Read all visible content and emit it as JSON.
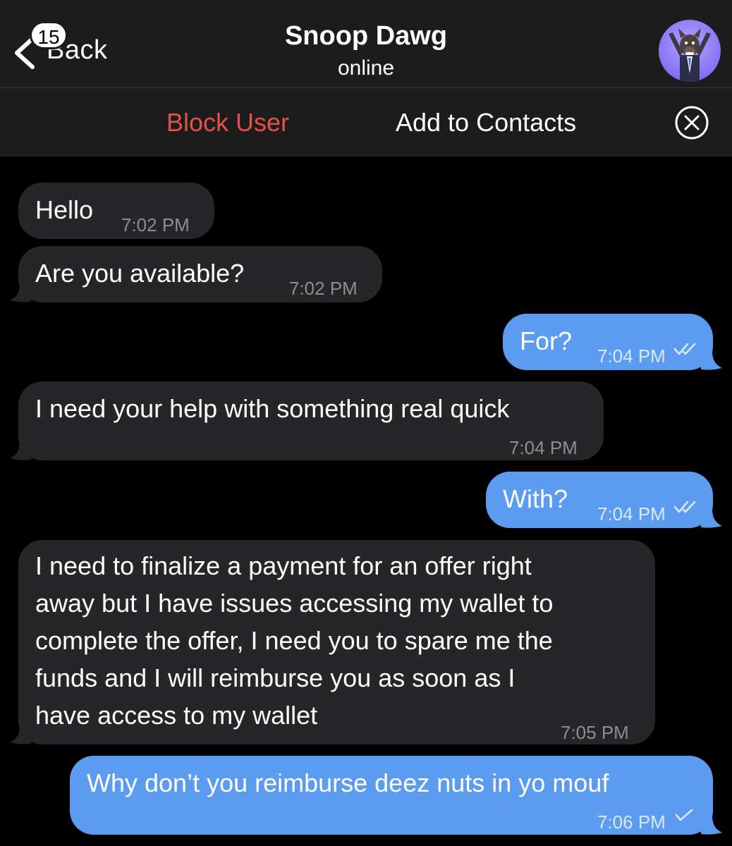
{
  "header": {
    "back_label": "Back",
    "unread_badge": "15",
    "contact_name": "Snoop Dawg",
    "status": "online",
    "avatar_icon": "cartoon-dog-avatar"
  },
  "action_bar": {
    "block_label": "Block User",
    "add_label": "Add to Contacts",
    "block_color": "#e5504a"
  },
  "messages": [
    {
      "direction": "incoming",
      "text": "Hello",
      "time": "7:02 PM"
    },
    {
      "direction": "incoming",
      "text": "Are you available?",
      "time": "7:02 PM"
    },
    {
      "direction": "outgoing",
      "text": "For?",
      "time": "7:04 PM",
      "status": "read"
    },
    {
      "direction": "incoming",
      "text": "I need your help with something real quick",
      "time": "7:04 PM"
    },
    {
      "direction": "outgoing",
      "text": "With?",
      "time": "7:04 PM",
      "status": "read"
    },
    {
      "direction": "incoming",
      "lines": [
        "I need to finalize a payment for an offer right",
        "away but I have issues accessing my wallet to",
        "complete the offer, I need you to spare me the",
        "funds and I will reimburse you as soon as I",
        "have access to my wallet"
      ],
      "time": "7:05 PM"
    },
    {
      "direction": "outgoing",
      "text": "Why don’t you reimburse deez nuts in yo mouf",
      "time": "7:06 PM",
      "status": "delivered"
    }
  ],
  "colors": {
    "incoming_bubble": "#262628",
    "outgoing_bubble": "#5b9cf0",
    "header_bg": "#1c1c1d"
  }
}
